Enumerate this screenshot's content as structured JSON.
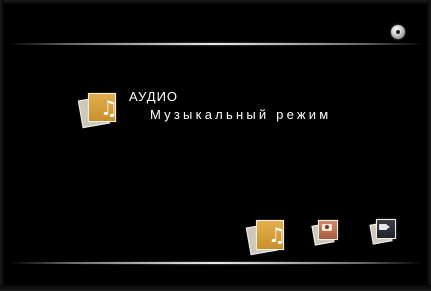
{
  "header": {
    "disc_icon": "disc-icon"
  },
  "mode": {
    "title": "АУДИО",
    "subtitle": "Музыкальный режим",
    "icon": "audio-note-icon",
    "accent_color": "#d9a040"
  },
  "bottom_bar": {
    "items": [
      {
        "name": "audio",
        "icon": "audio-note-icon",
        "selected": true
      },
      {
        "name": "photo",
        "icon": "photo-camera-icon",
        "selected": false
      },
      {
        "name": "video",
        "icon": "video-camera-icon",
        "selected": false
      }
    ]
  }
}
